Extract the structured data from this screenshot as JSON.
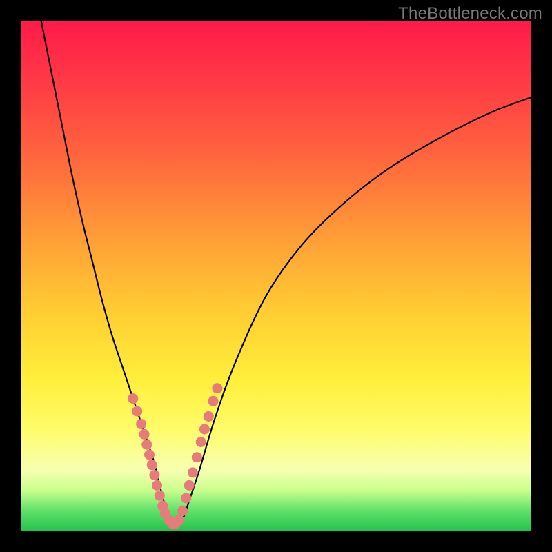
{
  "watermark": "TheBottleneck.com",
  "chart_data": {
    "type": "line",
    "title": "",
    "xlabel": "",
    "ylabel": "",
    "xlim": [
      0,
      100
    ],
    "ylim": [
      0,
      100
    ],
    "series": [
      {
        "name": "bottleneck-curve",
        "x": [
          4,
          6,
          8,
          10,
          12,
          14,
          16,
          18,
          20,
          22,
          24,
          26,
          27,
          28,
          29,
          30,
          31,
          32,
          33,
          35,
          38,
          42,
          48,
          55,
          63,
          72,
          82,
          92,
          100
        ],
        "values": [
          100,
          90,
          80,
          70,
          61,
          53,
          45,
          38,
          32,
          26,
          20,
          14,
          10,
          6,
          3,
          1.5,
          1.5,
          3,
          6,
          12,
          22,
          33,
          46,
          56,
          64,
          71,
          77,
          82,
          85
        ]
      }
    ],
    "markers": {
      "name": "highlighted-points",
      "comment": "points on the curve highlighted with pink dots near the valley",
      "x": [
        22.0,
        22.8,
        23.6,
        24.2,
        24.7,
        25.2,
        25.7,
        26.2,
        26.7,
        27.2,
        27.8,
        28.3,
        29.0,
        29.7,
        30.3,
        31.0,
        31.7,
        32.4,
        33.0,
        33.7,
        34.5,
        35.3,
        36.0,
        36.8,
        37.7,
        38.5
      ],
      "values": [
        26.0,
        23.5,
        21.0,
        19.0,
        17.0,
        15.0,
        13.0,
        11.0,
        9.0,
        7.0,
        5.0,
        3.5,
        2.2,
        1.5,
        1.5,
        2.2,
        4.0,
        6.5,
        9.0,
        11.5,
        14.5,
        17.5,
        20.0,
        22.5,
        25.5,
        28.0
      ]
    },
    "gradient_bands": {
      "comment": "background vertical gradient, top=100 bottom=0",
      "stops": [
        {
          "pos": 100,
          "color": "#ff1a4a"
        },
        {
          "pos": 70,
          "color": "#ff8a38"
        },
        {
          "pos": 40,
          "color": "#ffe234"
        },
        {
          "pos": 15,
          "color": "#fcff9a"
        },
        {
          "pos": 4,
          "color": "#6ae06e"
        },
        {
          "pos": 0,
          "color": "#23c24b"
        }
      ]
    }
  }
}
